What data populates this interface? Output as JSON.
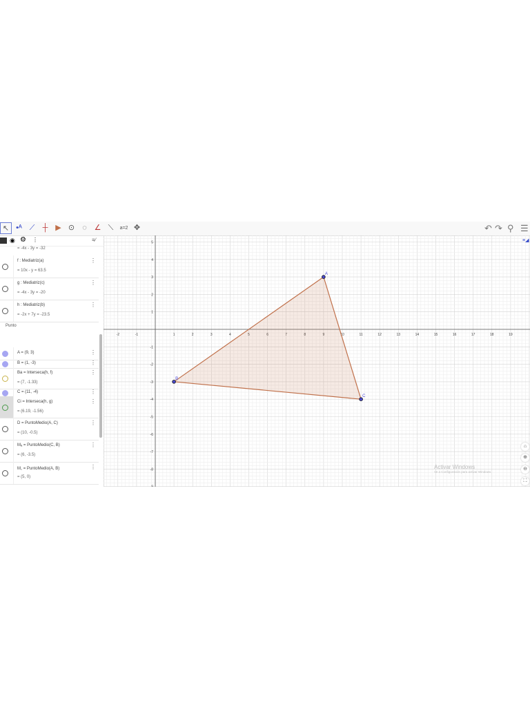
{
  "toolbar": {
    "tools": [
      "move-tool",
      "point-tool",
      "line-tool",
      "perpendicular-tool",
      "polygon-tool",
      "circle-tool",
      "conic-tool",
      "angle-tool",
      "reflect-tool",
      "slider-tool",
      "move-view-tool"
    ],
    "right_icons": [
      "undo-icon",
      "redo-icon",
      "search-icon",
      "menu-icon"
    ]
  },
  "algebra": {
    "top_partial": "= -4x - 3y = -32",
    "rows": [
      {
        "l1": "f : Mediatriz(a)",
        "l2": "= 10x - y = 63.5",
        "marker": "empty"
      },
      {
        "l1": "g : Mediatriz(c)",
        "l2": "= -4x - 3y = -20",
        "marker": "empty"
      },
      {
        "l1": "h : Mediatriz(b)",
        "l2": "= -2x + 7y = -23.5",
        "marker": "empty"
      },
      {
        "l1": "A = (9, 3)",
        "marker": "filled"
      },
      {
        "l1": "B = (1, -3)",
        "marker": "filled"
      },
      {
        "l1": "Bа = Interseca(h, f)",
        "l2": "= (7, -1.33)",
        "marker": "yellow"
      },
      {
        "l1": "C = (11, -4)",
        "marker": "filled"
      },
      {
        "l1": "Ci = Interseca(h, g)",
        "l2": "= (6.19, -1.56)",
        "marker": "green"
      },
      {
        "l1": "D = PuntoMedio(A, C)",
        "l2": "= (10, -0.5)",
        "marker": "empty"
      },
      {
        "l1": "Mₐ = PuntoMedio(C, B)",
        "l2": "= (6, -3.5)",
        "marker": "empty"
      },
      {
        "l1": "M꜀ = PuntoMedio(A, B)",
        "l2": "= (5, 0)",
        "marker": "empty"
      }
    ],
    "group_label": "Punto"
  },
  "graph": {
    "points": [
      {
        "name": "A",
        "x": 9,
        "y": 3
      },
      {
        "name": "B",
        "x": 1,
        "y": -3
      },
      {
        "name": "C",
        "x": 11,
        "y": -4
      }
    ],
    "xticks": [
      -2,
      -1,
      1,
      2,
      3,
      4,
      5,
      6,
      7,
      8,
      9,
      10,
      11,
      12,
      13,
      14,
      15,
      16,
      17,
      18,
      19
    ],
    "yticks": [
      5,
      4,
      3,
      2,
      1,
      -1,
      -2,
      -3,
      -4,
      -5,
      -6,
      -7,
      -8,
      -9
    ],
    "polygon_color": "#c0704a"
  },
  "watermark": {
    "title": "Activar Windows",
    "sub": "Ve a Configuración para activar Windows."
  }
}
